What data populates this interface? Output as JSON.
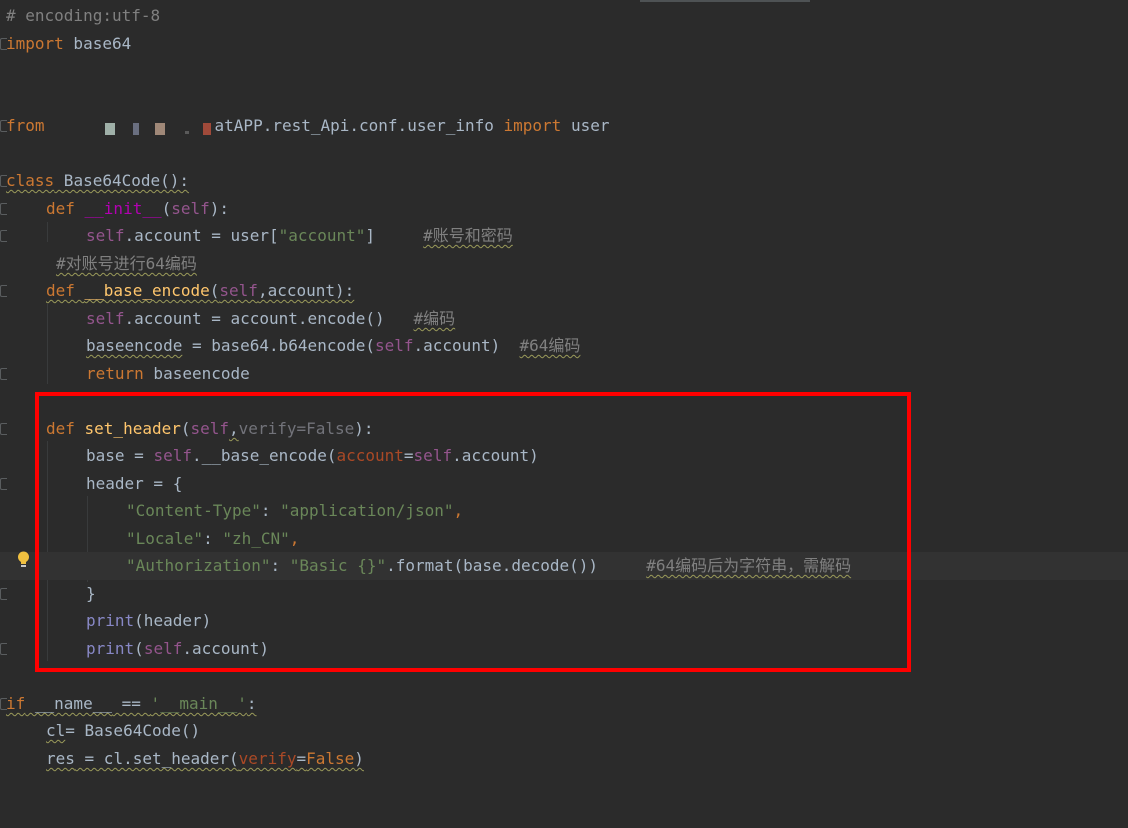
{
  "colors": {
    "background": "#2b2b2b",
    "current_line": "#323232",
    "keyword": "#cc7832",
    "comment": "#808080",
    "string": "#6a8759",
    "self": "#94558d",
    "function_name": "#ffc66d",
    "magic_method": "#b200b2",
    "builtin": "#8888c6",
    "param_name": "#aa4926",
    "highlight_box": "#ff0000",
    "bulb": "#f0c040"
  },
  "code": {
    "l1_comment": "# encoding:utf-8",
    "l2_import": "import",
    "l2_module": " base64",
    "l4_from": "from",
    "l4_module": "atAPP.rest_Api.conf.user_info ",
    "l4_import": "import",
    "l4_name": " user",
    "l6_class": "class",
    "l6_name": " Base64Code():",
    "l7_def": "def ",
    "l7_name": "__init__",
    "l7_open": "(",
    "l7_self": "self",
    "l7_close": "):",
    "l8_self": "self",
    "l8_text": ".account = user[",
    "l8_str": "\"account\"",
    "l8_close": "]     ",
    "l8_comment": "#账号和密码",
    "l9_comment": "#对账号进行64编码",
    "l10_def": "def ",
    "l10_name": "__base_encode",
    "l10_open": "(",
    "l10_self": "self",
    "l10_rest": ",account):",
    "l11_self": "self",
    "l11_text": ".account = account.encode()   ",
    "l11_comment": "#编码",
    "l12_var": "baseencode",
    "l12_text": " = base64.b64encode(",
    "l12_self": "self",
    "l12_close": ".account)  ",
    "l12_comment": "#64编码",
    "l13_return": "return",
    "l13_text": " baseencode",
    "l15_def": "def ",
    "l15_name": "set_header",
    "l15_open": "(",
    "l15_self": "self",
    "l15_comma": ",",
    "l15_param": "verify=False",
    "l15_close": "):",
    "l16_text": "base = ",
    "l16_self": "self",
    "l16_call": ".__base_encode(",
    "l16_kw": "account",
    "l16_eq": "=",
    "l16_self2": "self",
    "l16_close": ".account)",
    "l17_text": "header = {",
    "l18_key": "\"Content-Type\"",
    "l18_colon": ": ",
    "l18_val": "\"application/json\"",
    "l18_comma": ",",
    "l19_key": "\"Locale\"",
    "l19_colon": ": ",
    "l19_val": "\"zh_CN\"",
    "l19_comma": ",",
    "l20_key": "\"Authorization\"",
    "l20_colon": ": ",
    "l20_val": "\"Basic {}\"",
    "l20_text": ".format(base.decode())     ",
    "l20_comment": "#64编码后为字符串，需解码",
    "l21_text": "}",
    "l22_print": "print",
    "l22_text": "(header)",
    "l23_print": "print",
    "l23_open": "(",
    "l23_self": "self",
    "l23_text": ".account)",
    "l25_if": "if",
    "l25_name": " __name__",
    "l25_eq": " == ",
    "l25_str": "'__main__'",
    "l25_colon": ":",
    "l26_var": "cl",
    "l26_text": "= Base64Code()",
    "l27_var": "res",
    "l27_text": " = cl.set_header(",
    "l27_kw": "verify",
    "l27_eq": "=",
    "l27_false": "False",
    "l27_close": ")"
  }
}
